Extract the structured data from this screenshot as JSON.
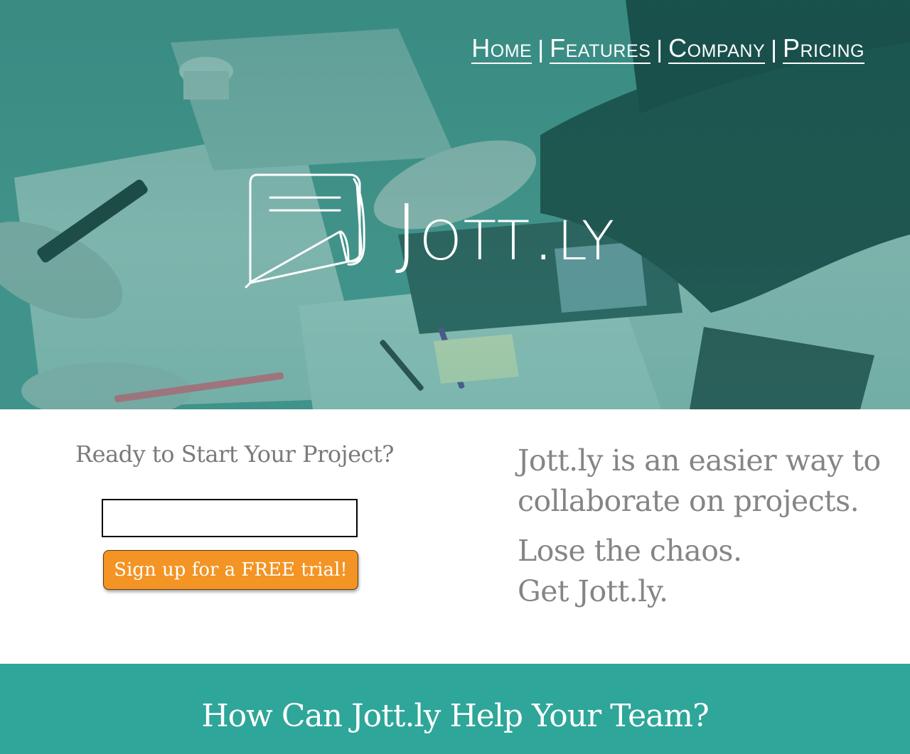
{
  "nav": {
    "items": [
      {
        "label": "Home"
      },
      {
        "label": "Features"
      },
      {
        "label": "Company"
      },
      {
        "label": "Pricing"
      }
    ],
    "separator": "|"
  },
  "hero": {
    "brand": "Jott.ly",
    "logo_icon": "notepad-icon",
    "overlay_color": "#2a8a80"
  },
  "signup": {
    "heading": "Ready to Start Your Project?",
    "input_value": "",
    "button_label": "Sign up for a FREE trial!",
    "button_color": "#f39424"
  },
  "pitch": {
    "description": "Jott.ly is an easier way to collaborate on projects.",
    "tagline_line1": "Lose the chaos.",
    "tagline_line2": "Get Jott.ly."
  },
  "band": {
    "heading": "How Can Jott.ly Help Your Team?",
    "color": "#2ea699"
  }
}
